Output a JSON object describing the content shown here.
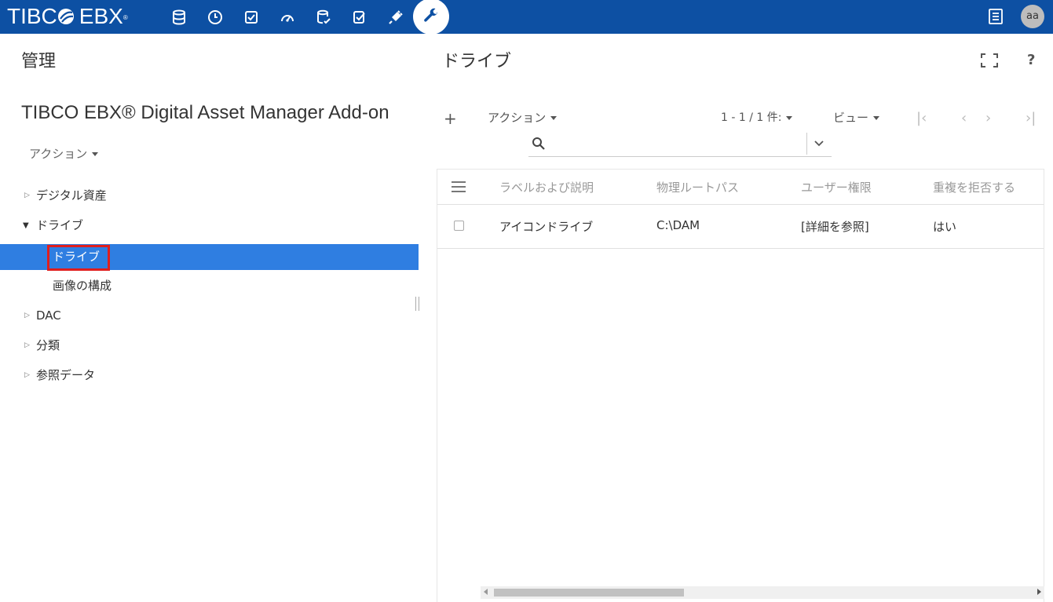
{
  "header": {
    "brand": "TIBC",
    "brand_tail": "EBX",
    "brand_mark": "®",
    "user_initials": "aa",
    "colors": {
      "bar": "#0d50a3",
      "selected": "#2f7ee1",
      "highlight_box": "#e01e1e"
    },
    "icons": [
      "database-icon",
      "clock-icon",
      "checkbox-icon",
      "dashboard-icon",
      "data-models-icon",
      "tasks-icon",
      "plugin-icon",
      "admin-wrench-icon",
      "menu-list-icon"
    ]
  },
  "left": {
    "title": "管理",
    "dataspace_title": "TIBCO EBX® Digital Asset Manager Add-on",
    "action_label": "アクション",
    "tree": {
      "digital_assets": "デジタル資産",
      "drives": "ドライブ",
      "drive_child": "ドライブ",
      "image_config": "画像の構成",
      "dac": "DAC",
      "classification": "分類",
      "reference_data": "参照データ"
    }
  },
  "right": {
    "title": "ドライブ",
    "toolbar": {
      "add": "+",
      "action_label": "アクション",
      "count": "1 - 1 / 1 件:",
      "view_label": "ビュー",
      "first": "|‹",
      "prev": "‹",
      "next": "›",
      "last": "›|"
    },
    "search": {
      "placeholder": "",
      "value": ""
    },
    "table": {
      "columns": [
        "ラベルおよび説明",
        "物理ルートパス",
        "ユーザー権限",
        "重複を拒否する"
      ],
      "rows": [
        {
          "label": "アイコンドライブ",
          "path": "C:\\DAM",
          "permissions": "[詳細を参照]",
          "reject_duplicates": "はい",
          "checked": false
        }
      ]
    },
    "help": "?"
  }
}
